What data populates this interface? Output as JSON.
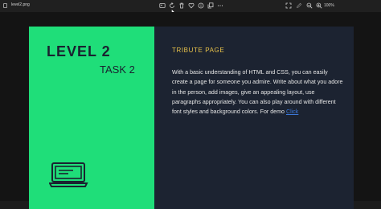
{
  "window": {
    "file_name": "level2.png",
    "zoom": "100%"
  },
  "toolbar": {
    "icons": [
      "image-edit-icon",
      "rotate-icon",
      "delete-icon",
      "favorite-heart-icon",
      "info-icon",
      "copy-icon",
      "more-icon",
      "fullscreen-icon",
      "pen-icon",
      "zoom-out-icon",
      "zoom-in-icon"
    ]
  },
  "slide": {
    "level": "LEVEL 2",
    "task": "TASK 2",
    "heading": "TRIBUTE PAGE",
    "body": "With a basic understanding of HTML and CSS, you can easily create a page for someone you admire. Write about what you adore in the person, add images, give an appealing layout, use paragraphs appropriately. You can also play around with different font styles and background colors. For demo",
    "link_text": "Click",
    "colors": {
      "green_panel": "#1fde79",
      "dark_background": "#1c2331",
      "heading": "#e8c24a",
      "link": "#3b78d8"
    }
  }
}
